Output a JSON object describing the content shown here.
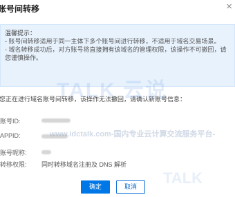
{
  "dialog": {
    "title": "账号间转移",
    "close_label": "×"
  },
  "notice": {
    "heading": "温馨提示：",
    "line1": "- 账号间转移适用于同一主体下多个账号间进行转移，不适用于域名交易场景。",
    "line2": "- 域名转移成功后，对方账号将直接拥有该域名的管理权限，该操作不可撤回，请",
    "line3": "您谨慎操作。"
  },
  "intro": "您正在进行域名账号间转移，该操作无法撤回，请确认新账号信息：",
  "fields": [
    {
      "label": "账号ID:"
    },
    {
      "label": "APPID:"
    },
    {
      "label": "账号昵称:"
    },
    {
      "label": "转移权限:",
      "value": "同时转移域名注册及 DNS 解析"
    }
  ],
  "buttons": {
    "ok": "确定",
    "cancel": "取消"
  },
  "watermark": {
    "logo": "TALK 云说",
    "text": "www.idctalk.com-国内专业云计算交流服务平台-",
    "logo2": "TALK"
  }
}
